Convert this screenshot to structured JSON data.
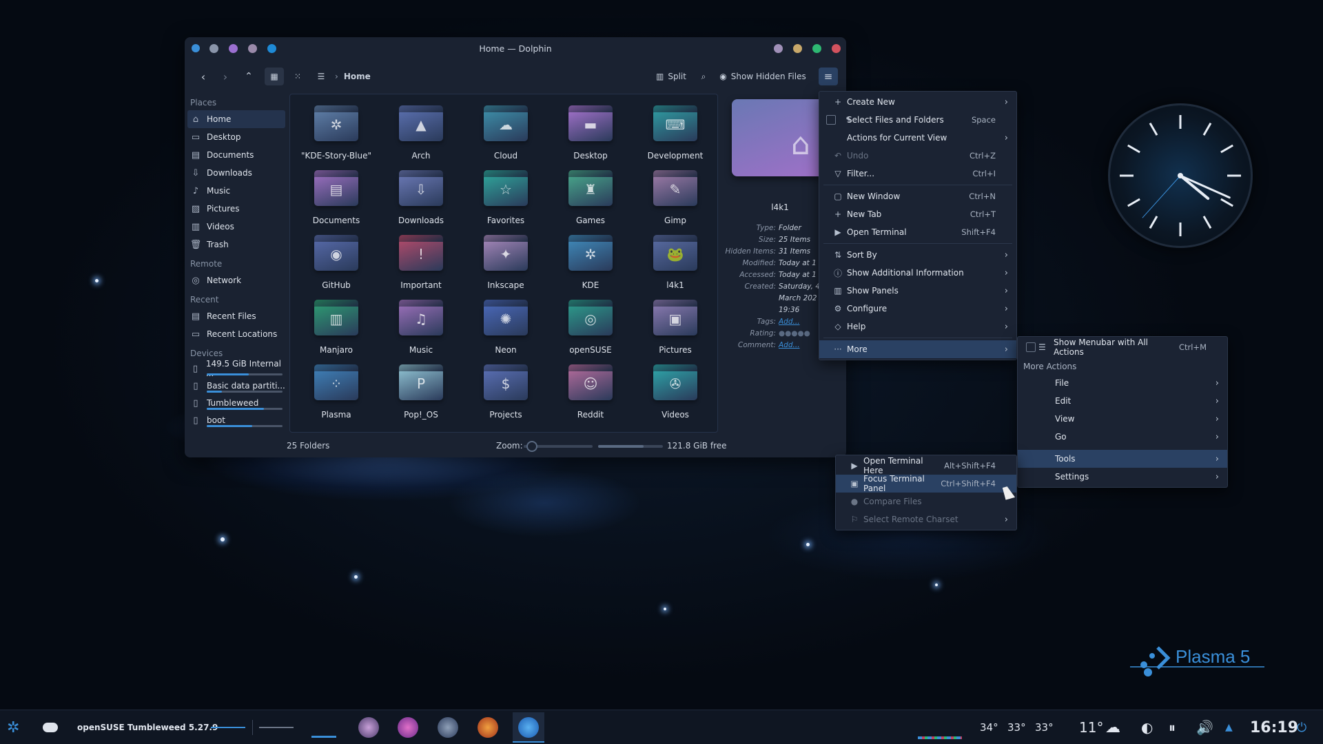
{
  "window": {
    "title": "Home — Dolphin",
    "breadcrumb": "Home",
    "split_label": "Split",
    "hidden_label": "Show Hidden Files"
  },
  "places": {
    "places_header": "Places",
    "places": [
      "Home",
      "Desktop",
      "Documents",
      "Downloads",
      "Music",
      "Pictures",
      "Videos",
      "Trash"
    ],
    "remote_header": "Remote",
    "remote": [
      "Network"
    ],
    "recent_header": "Recent",
    "recent": [
      "Recent Files",
      "Recent Locations"
    ],
    "devices_header": "Devices",
    "devices": [
      "149.5 GiB Internal ...",
      "Basic data partiti...",
      "Tumbleweed",
      "boot"
    ]
  },
  "device_usage": [
    0.55,
    0.2,
    0.75,
    0.6
  ],
  "folders": [
    {
      "name": "\"KDE-Story-Blue\"",
      "color": "#5f7fa8",
      "glyph": "✲"
    },
    {
      "name": "Arch",
      "color": "#5a6fae",
      "glyph": "▲"
    },
    {
      "name": "Cloud",
      "color": "#3d8ea8",
      "glyph": "☁"
    },
    {
      "name": "Desktop",
      "color": "#a070c8",
      "glyph": "▬"
    },
    {
      "name": "Development",
      "color": "#2f9aa0",
      "glyph": "⌨"
    },
    {
      "name": "Documents",
      "color": "#9b6fbf",
      "glyph": "▤"
    },
    {
      "name": "Downloads",
      "color": "#6a78b4",
      "glyph": "⇩"
    },
    {
      "name": "Favorites",
      "color": "#2fa49a",
      "glyph": "☆"
    },
    {
      "name": "Games",
      "color": "#48a58a",
      "glyph": "♜"
    },
    {
      "name": "Gimp",
      "color": "#9c7aa6",
      "glyph": "✎"
    },
    {
      "name": "GitHub",
      "color": "#5669a8",
      "glyph": "◉"
    },
    {
      "name": "Important",
      "color": "#b04a6a",
      "glyph": "!"
    },
    {
      "name": "Inkscape",
      "color": "#a486b8",
      "glyph": "✦"
    },
    {
      "name": "KDE",
      "color": "#3f88b8",
      "glyph": "✲"
    },
    {
      "name": "l4k1",
      "color": "#586aa0",
      "glyph": "🐸"
    },
    {
      "name": "Manjaro",
      "color": "#2e9a72",
      "glyph": "▥"
    },
    {
      "name": "Music",
      "color": "#9a6fb8",
      "glyph": "♫"
    },
    {
      "name": "Neon",
      "color": "#4a68b8",
      "glyph": "✺"
    },
    {
      "name": "openSUSE",
      "color": "#2c9a8a",
      "glyph": "◎"
    },
    {
      "name": "Pictures",
      "color": "#8a7ab0",
      "glyph": "▣"
    },
    {
      "name": "Plasma",
      "color": "#3f80b8",
      "glyph": "⁘"
    },
    {
      "name": "Pop!_OS",
      "color": "#8ec0d0",
      "glyph": "P"
    },
    {
      "name": "Projects",
      "color": "#5a6fb4",
      "glyph": "$"
    },
    {
      "name": "Reddit",
      "color": "#b06a9a",
      "glyph": "☺"
    },
    {
      "name": "Videos",
      "color": "#2ea4a8",
      "glyph": "✇"
    }
  ],
  "info": {
    "name": "l4k1",
    "rows": [
      [
        "Type:",
        "Folder"
      ],
      [
        "Size:",
        "25 Items"
      ],
      [
        "Hidden Items:",
        "31 Items"
      ],
      [
        "Modified:",
        "Today at 1"
      ],
      [
        "Accessed:",
        "Today at 1"
      ],
      [
        "Created:",
        "Saturday, 4"
      ],
      [
        "",
        "March 202"
      ],
      [
        "",
        "19:36"
      ],
      [
        "Tags:",
        "Add..."
      ],
      [
        "Rating:",
        ""
      ],
      [
        "Comment:",
        "Add..."
      ]
    ]
  },
  "status": {
    "count": "25 Folders",
    "zoom_label": "Zoom:",
    "free": "121.8 GiB free",
    "zoom_level": 0.12,
    "free_ratio": 0.7
  },
  "main_menu": [
    {
      "icon": "+",
      "label": "Create New",
      "sc": "",
      "arrow": true
    },
    {
      "icon": "✎",
      "label": "Select Files and Folders",
      "sc": "Space",
      "check": true
    },
    {
      "icon": "",
      "label": "Actions for Current View",
      "sc": "",
      "arrow": true
    },
    {
      "icon": "↶",
      "label": "Undo",
      "sc": "Ctrl+Z",
      "dis": true
    },
    {
      "icon": "▽",
      "label": "Filter...",
      "sc": "Ctrl+I"
    },
    {
      "sep": true
    },
    {
      "icon": "▢",
      "label": "New Window",
      "sc": "Ctrl+N"
    },
    {
      "icon": "+",
      "label": "New Tab",
      "sc": "Ctrl+T"
    },
    {
      "icon": "▶",
      "label": "Open Terminal",
      "sc": "Shift+F4"
    },
    {
      "sep": true
    },
    {
      "icon": "⇅",
      "label": "Sort By",
      "sc": "",
      "arrow": true
    },
    {
      "icon": "ⓘ",
      "label": "Show Additional Information",
      "sc": "",
      "arrow": true
    },
    {
      "icon": "▥",
      "label": "Show Panels",
      "sc": "",
      "arrow": true
    },
    {
      "icon": "⚙",
      "label": "Configure",
      "sc": "",
      "arrow": true
    },
    {
      "icon": "◇",
      "label": "Help",
      "sc": "",
      "arrow": true
    },
    {
      "sep": true
    },
    {
      "icon": "···",
      "label": "More",
      "sc": "",
      "arrow": true,
      "hl": true
    }
  ],
  "more_menu": {
    "show_menubar": "Show Menubar with All Actions",
    "show_menubar_sc": "Ctrl+M",
    "header": "More Actions",
    "items": [
      "File",
      "Edit",
      "View",
      "Go",
      "Tools",
      "Settings"
    ]
  },
  "tools_menu": [
    {
      "icon": "▶",
      "label": "Open Terminal Here",
      "sc": "Alt+Shift+F4"
    },
    {
      "icon": "▣",
      "label": "Focus Terminal Panel",
      "sc": "Ctrl+Shift+F4",
      "hl": true
    },
    {
      "icon": "●",
      "label": "Compare Files",
      "sc": "",
      "dis": true
    },
    {
      "icon": "⚐",
      "label": "Select Remote Charset",
      "sc": "",
      "dis": true,
      "arrow": true
    }
  ],
  "branding": {
    "plasma": "Plasma 5"
  },
  "taskbar": {
    "os_label": "openSUSE Tumbleweed 5.27.9",
    "temps": [
      "34°",
      "33°",
      "33°"
    ],
    "weather": "11°",
    "clock": "16:19"
  },
  "clock_widget": {
    "hour": 4,
    "minute": 19,
    "second": 37
  },
  "colors": {
    "accent": "#3a8fd9",
    "menu_bg": "#1b2333",
    "highlight": "#2a4163"
  }
}
